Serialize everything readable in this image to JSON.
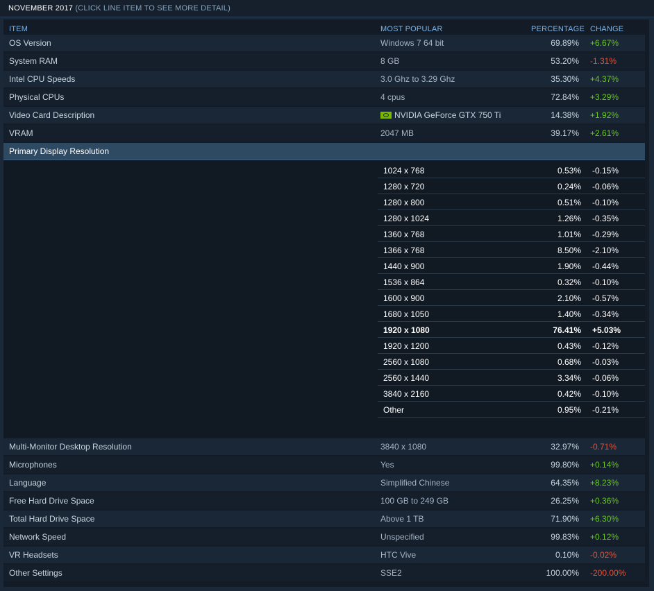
{
  "header": {
    "title": "NOVEMBER 2017",
    "note": "(CLICK LINE ITEM TO SEE MORE DETAIL)"
  },
  "columns": {
    "item": "ITEM",
    "most_popular": "MOST POPULAR",
    "percentage": "PERCENTAGE",
    "change": "CHANGE"
  },
  "rows_top": [
    {
      "item": "OS Version",
      "popular": "Windows 7 64 bit",
      "pct": "69.89%",
      "chg": "+6.67%",
      "dir": "pos"
    },
    {
      "item": "System RAM",
      "popular": "8 GB",
      "pct": "53.20%",
      "chg": "-1.31%",
      "dir": "neg"
    },
    {
      "item": "Intel CPU Speeds",
      "popular": "3.0 Ghz to 3.29 Ghz",
      "pct": "35.30%",
      "chg": "+4.37%",
      "dir": "pos"
    },
    {
      "item": "Physical CPUs",
      "popular": "4 cpus",
      "pct": "72.84%",
      "chg": "+3.29%",
      "dir": "pos"
    },
    {
      "item": "Video Card Description",
      "popular": "NVIDIA GeForce GTX 750 Ti",
      "pct": "14.38%",
      "chg": "+1.92%",
      "dir": "pos",
      "icon": "nvidia-logo-icon"
    },
    {
      "item": "VRAM",
      "popular": "2047 MB",
      "pct": "39.17%",
      "chg": "+2.61%",
      "dir": "pos"
    }
  ],
  "section": {
    "label": "Primary Display Resolution"
  },
  "resolutions": [
    {
      "name": "1024 x 768",
      "pct": "0.53%",
      "chg": "-0.15%",
      "dir": "neg"
    },
    {
      "name": "1280 x 720",
      "pct": "0.24%",
      "chg": "-0.06%",
      "dir": "neg"
    },
    {
      "name": "1280 x 800",
      "pct": "0.51%",
      "chg": "-0.10%",
      "dir": "neg"
    },
    {
      "name": "1280 x 1024",
      "pct": "1.26%",
      "chg": "-0.35%",
      "dir": "neg"
    },
    {
      "name": "1360 x 768",
      "pct": "1.01%",
      "chg": "-0.29%",
      "dir": "neg"
    },
    {
      "name": "1366 x 768",
      "pct": "8.50%",
      "chg": "-2.10%",
      "dir": "neg"
    },
    {
      "name": "1440 x 900",
      "pct": "1.90%",
      "chg": "-0.44%",
      "dir": "neg"
    },
    {
      "name": "1536 x 864",
      "pct": "0.32%",
      "chg": "-0.10%",
      "dir": "neg"
    },
    {
      "name": "1600 x 900",
      "pct": "2.10%",
      "chg": "-0.57%",
      "dir": "neg"
    },
    {
      "name": "1680 x 1050",
      "pct": "1.40%",
      "chg": "-0.34%",
      "dir": "neg"
    },
    {
      "name": "1920 x 1080",
      "pct": "76.41%",
      "chg": "+5.03%",
      "dir": "pos",
      "bold": true
    },
    {
      "name": "1920 x 1200",
      "pct": "0.43%",
      "chg": "-0.12%",
      "dir": "neg"
    },
    {
      "name": "2560 x 1080",
      "pct": "0.68%",
      "chg": "-0.03%",
      "dir": "neg"
    },
    {
      "name": "2560 x 1440",
      "pct": "3.34%",
      "chg": "-0.06%",
      "dir": "neg"
    },
    {
      "name": "3840 x 2160",
      "pct": "0.42%",
      "chg": "-0.10%",
      "dir": "neg"
    },
    {
      "name": "Other",
      "pct": "0.95%",
      "chg": "-0.21%",
      "dir": "neg"
    }
  ],
  "rows_bottom": [
    {
      "item": "Multi-Monitor Desktop Resolution",
      "popular": "3840 x 1080",
      "pct": "32.97%",
      "chg": "-0.71%",
      "dir": "neg"
    },
    {
      "item": "Microphones",
      "popular": "Yes",
      "pct": "99.80%",
      "chg": "+0.14%",
      "dir": "pos"
    },
    {
      "item": "Language",
      "popular": "Simplified Chinese",
      "pct": "64.35%",
      "chg": "+8.23%",
      "dir": "pos"
    },
    {
      "item": "Free Hard Drive Space",
      "popular": "100 GB to 249 GB",
      "pct": "26.25%",
      "chg": "+0.36%",
      "dir": "pos"
    },
    {
      "item": "Total Hard Drive Space",
      "popular": "Above 1 TB",
      "pct": "71.90%",
      "chg": "+6.30%",
      "dir": "pos"
    },
    {
      "item": "Network Speed",
      "popular": "Unspecified",
      "pct": "99.83%",
      "chg": "+0.12%",
      "dir": "pos"
    },
    {
      "item": "VR Headsets",
      "popular": "HTC Vive",
      "pct": "0.10%",
      "chg": "-0.02%",
      "dir": "neg"
    },
    {
      "item": "Other Settings",
      "popular": "SSE2",
      "pct": "100.00%",
      "chg": "-200.00%",
      "dir": "neg"
    }
  ]
}
